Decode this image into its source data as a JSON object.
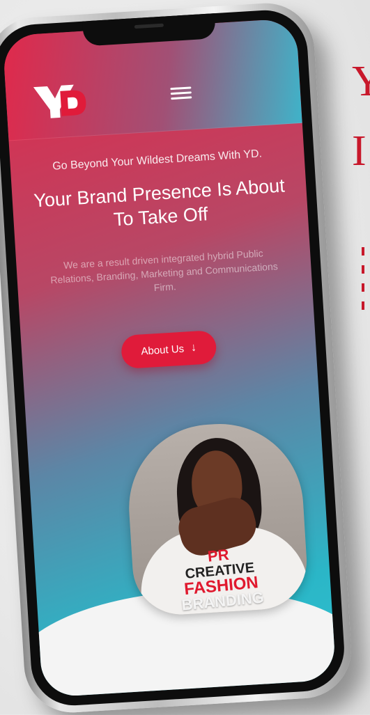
{
  "background": {
    "title_line1": "Y",
    "title_line2": "I",
    "accent_color": "#c8182b"
  },
  "header": {
    "logo_text": "YD",
    "logo_colors": {
      "primary": "#ffffff",
      "secondary": "#e01b3a"
    },
    "menu_icon": "hamburger-menu-icon"
  },
  "hero": {
    "tagline": "Go Beyond Your Wildest Dreams With YD.",
    "headline": "Your Brand Presence Is About To Take Off",
    "description": "We are a result driven integrated hybrid Public Relations, Branding, Marketing and Communications Firm.",
    "cta_label": "About Us",
    "cta_icon": "arrow-down-icon",
    "cta_color": "#e01b3a"
  },
  "photo": {
    "overlay_lines": [
      "PR",
      "CREATIVE",
      "FASHION",
      "BRANDING"
    ]
  }
}
